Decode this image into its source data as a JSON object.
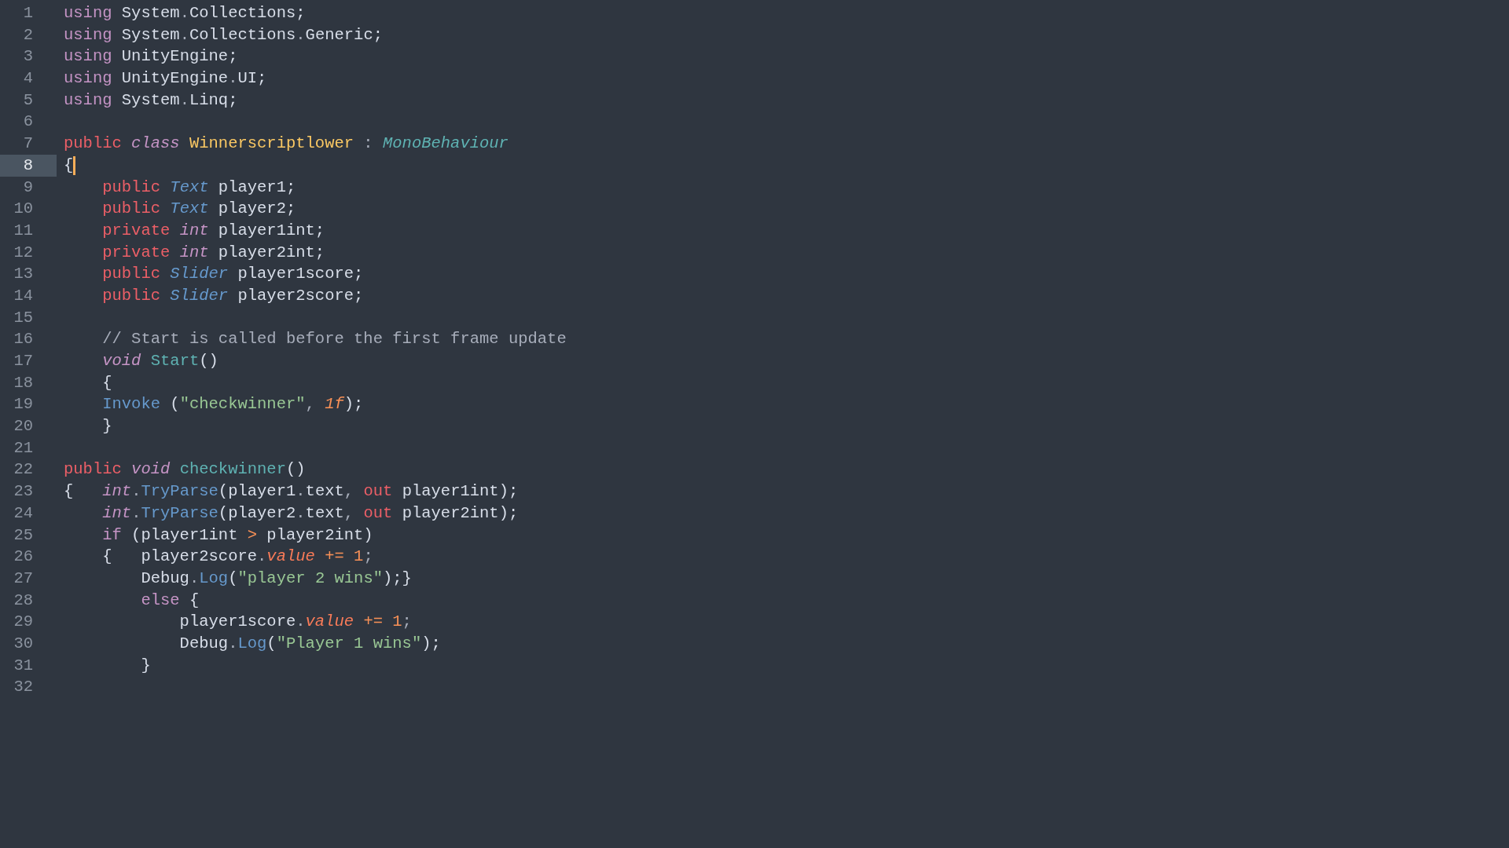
{
  "editor": {
    "lines": [
      {
        "number": "1",
        "selected": false,
        "tokens": [
          {
            "t": "using",
            "kind": "kw"
          },
          {
            "t": " System",
            "kind": "p"
          },
          {
            "t": ".",
            "kind": "pu"
          },
          {
            "t": "Collections;",
            "kind": "p"
          }
        ]
      },
      {
        "number": "2",
        "selected": false,
        "tokens": [
          {
            "t": "using",
            "kind": "kw"
          },
          {
            "t": " System",
            "kind": "p"
          },
          {
            "t": ".",
            "kind": "pu"
          },
          {
            "t": "Collections",
            "kind": "p"
          },
          {
            "t": ".",
            "kind": "pu"
          },
          {
            "t": "Generic;",
            "kind": "p"
          }
        ]
      },
      {
        "number": "3",
        "selected": false,
        "tokens": [
          {
            "t": "using",
            "kind": "kw"
          },
          {
            "t": " UnityEngine;",
            "kind": "p"
          }
        ]
      },
      {
        "number": "4",
        "selected": false,
        "tokens": [
          {
            "t": "using",
            "kind": "kw"
          },
          {
            "t": " UnityEngine",
            "kind": "p"
          },
          {
            "t": ".",
            "kind": "pu"
          },
          {
            "t": "UI;",
            "kind": "p"
          }
        ]
      },
      {
        "number": "5",
        "selected": false,
        "tokens": [
          {
            "t": "using",
            "kind": "kw"
          },
          {
            "t": " System",
            "kind": "p"
          },
          {
            "t": ".",
            "kind": "pu"
          },
          {
            "t": "Linq;",
            "kind": "p"
          }
        ]
      },
      {
        "number": "6",
        "selected": false
      },
      {
        "number": "7",
        "selected": false,
        "tokens": [
          {
            "t": "public",
            "kind": "mod"
          },
          {
            "t": " class",
            "kind": "it"
          },
          {
            "t": " Winnerscriptlower",
            "kind": "cls"
          },
          {
            "t": " :",
            "kind": "pu"
          },
          {
            "t": " MonoBehaviour",
            "kind": "base"
          }
        ]
      },
      {
        "number": "8",
        "selected": true,
        "tokens": [
          {
            "t": "{",
            "kind": "p"
          }
        ]
      },
      {
        "number": "9",
        "selected": false,
        "tokens": [
          {
            "t": "    public",
            "kind": "mod"
          },
          {
            "t": " Text",
            "kind": "tt"
          },
          {
            "t": " player1;",
            "kind": "p"
          }
        ]
      },
      {
        "number": "10",
        "selected": false,
        "tokens": [
          {
            "t": "    public",
            "kind": "mod"
          },
          {
            "t": " Text",
            "kind": "tt"
          },
          {
            "t": " player2;",
            "kind": "p"
          }
        ]
      },
      {
        "number": "11",
        "selected": false,
        "tokens": [
          {
            "t": "    private",
            "kind": "mod"
          },
          {
            "t": " int",
            "kind": "it"
          },
          {
            "t": " player1int;",
            "kind": "p"
          }
        ]
      },
      {
        "number": "12",
        "selected": false,
        "tokens": [
          {
            "t": "    private",
            "kind": "mod"
          },
          {
            "t": " int",
            "kind": "it"
          },
          {
            "t": " player2int;",
            "kind": "p"
          }
        ]
      },
      {
        "number": "13",
        "selected": false,
        "tokens": [
          {
            "t": "    public",
            "kind": "mod"
          },
          {
            "t": " Slider",
            "kind": "tt"
          },
          {
            "t": " player1score;",
            "kind": "p"
          }
        ]
      },
      {
        "number": "14",
        "selected": false,
        "tokens": [
          {
            "t": "    public",
            "kind": "mod"
          },
          {
            "t": " Slider",
            "kind": "tt"
          },
          {
            "t": " player2score;",
            "kind": "p"
          }
        ]
      },
      {
        "number": "15",
        "selected": false
      },
      {
        "number": "16",
        "selected": false,
        "tokens": [
          {
            "t": "    // Start is called before the first frame update",
            "kind": "cm"
          }
        ]
      },
      {
        "number": "17",
        "selected": false,
        "tokens": [
          {
            "t": "    void",
            "kind": "it"
          },
          {
            "t": " Start",
            "kind": "fn"
          },
          {
            "t": "()",
            "kind": "p"
          }
        ]
      },
      {
        "number": "18",
        "selected": false,
        "tokens": [
          {
            "t": "    {",
            "kind": "p"
          }
        ]
      },
      {
        "number": "19",
        "selected": false,
        "tokens": [
          {
            "t": "    Invoke",
            "kind": "me"
          },
          {
            "t": " (",
            "kind": "p"
          },
          {
            "t": "\"checkwinner\"",
            "kind": "str"
          },
          {
            "t": ",",
            "kind": "pu"
          },
          {
            "t": " 1f",
            "kind": "numi"
          },
          {
            "t": ");",
            "kind": "p"
          }
        ]
      },
      {
        "number": "20",
        "selected": false,
        "tokens": [
          {
            "t": "    }",
            "kind": "p"
          }
        ]
      },
      {
        "number": "21",
        "selected": false
      },
      {
        "number": "22",
        "selected": false,
        "tokens": [
          {
            "t": "public",
            "kind": "mod"
          },
          {
            "t": " void",
            "kind": "it"
          },
          {
            "t": " checkwinner",
            "kind": "fn"
          },
          {
            "t": "()",
            "kind": "p"
          }
        ]
      },
      {
        "number": "23",
        "selected": false,
        "tokens": [
          {
            "t": "{",
            "kind": "p"
          },
          {
            "t": "   int",
            "kind": "it"
          },
          {
            "t": ".",
            "kind": "pu"
          },
          {
            "t": "TryParse",
            "kind": "me"
          },
          {
            "t": "(player1",
            "kind": "p"
          },
          {
            "t": ".",
            "kind": "pu"
          },
          {
            "t": "text",
            "kind": "p"
          },
          {
            "t": ",",
            "kind": "pu"
          },
          {
            "t": " out",
            "kind": "mod"
          },
          {
            "t": " player1int);",
            "kind": "p"
          }
        ]
      },
      {
        "number": "24",
        "selected": false,
        "tokens": [
          {
            "t": "    int",
            "kind": "it"
          },
          {
            "t": ".",
            "kind": "pu"
          },
          {
            "t": "TryParse",
            "kind": "me"
          },
          {
            "t": "(player2",
            "kind": "p"
          },
          {
            "t": ".",
            "kind": "pu"
          },
          {
            "t": "text",
            "kind": "p"
          },
          {
            "t": ",",
            "kind": "pu"
          },
          {
            "t": " out",
            "kind": "mod"
          },
          {
            "t": " player2int);",
            "kind": "p"
          }
        ]
      },
      {
        "number": "25",
        "selected": false,
        "tokens": [
          {
            "t": "    if",
            "kind": "kw"
          },
          {
            "t": " (player1int",
            "kind": "p"
          },
          {
            "t": " >",
            "kind": "op"
          },
          {
            "t": " player2int)",
            "kind": "p"
          }
        ]
      },
      {
        "number": "26",
        "selected": false,
        "tokens": [
          {
            "t": "    {   player2score",
            "kind": "p"
          },
          {
            "t": ".",
            "kind": "pu"
          },
          {
            "t": "value",
            "kind": "prop"
          },
          {
            "t": " +=",
            "kind": "op"
          },
          {
            "t": " 1",
            "kind": "num"
          },
          {
            "t": ";",
            "kind": "pu"
          }
        ]
      },
      {
        "number": "27",
        "selected": false,
        "tokens": [
          {
            "t": "        Debug",
            "kind": "p"
          },
          {
            "t": ".",
            "kind": "pu"
          },
          {
            "t": "Log",
            "kind": "me"
          },
          {
            "t": "(",
            "kind": "p"
          },
          {
            "t": "\"player 2 wins\"",
            "kind": "str"
          },
          {
            "t": ");}",
            "kind": "p"
          }
        ]
      },
      {
        "number": "28",
        "selected": false,
        "tokens": [
          {
            "t": "        else",
            "kind": "kw"
          },
          {
            "t": " {",
            "kind": "p"
          }
        ]
      },
      {
        "number": "29",
        "selected": false,
        "tokens": [
          {
            "t": "            player1score",
            "kind": "p"
          },
          {
            "t": ".",
            "kind": "pu"
          },
          {
            "t": "value",
            "kind": "prop"
          },
          {
            "t": " +=",
            "kind": "op"
          },
          {
            "t": " 1",
            "kind": "num"
          },
          {
            "t": ";",
            "kind": "pu"
          }
        ]
      },
      {
        "number": "30",
        "selected": false,
        "tokens": [
          {
            "t": "            Debug",
            "kind": "p"
          },
          {
            "t": ".",
            "kind": "pu"
          },
          {
            "t": "Log",
            "kind": "me"
          },
          {
            "t": "(",
            "kind": "p"
          },
          {
            "t": "\"Player 1 wins\"",
            "kind": "str"
          },
          {
            "t": ");",
            "kind": "p"
          }
        ]
      },
      {
        "number": "31",
        "selected": false,
        "tokens": [
          {
            "t": "        }",
            "kind": "p"
          }
        ]
      },
      {
        "number": "32",
        "selected": false
      }
    ]
  }
}
